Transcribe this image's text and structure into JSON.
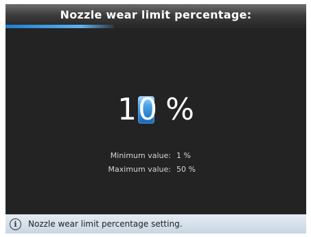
{
  "title": "Nozzle wear limit percentage:",
  "progress": {
    "fraction": 0.36,
    "color": "#3f9be4"
  },
  "value": {
    "digit_static": "1",
    "digit_active": "0",
    "unit": "%"
  },
  "limits": {
    "min_label": "Minimum value:",
    "min_value": "1 %",
    "max_label": "Maximum value:",
    "max_value": "50 %"
  },
  "status": {
    "icon": "info-icon",
    "icon_glyph": "i",
    "text": "Nozzle wear limit percentage setting."
  }
}
